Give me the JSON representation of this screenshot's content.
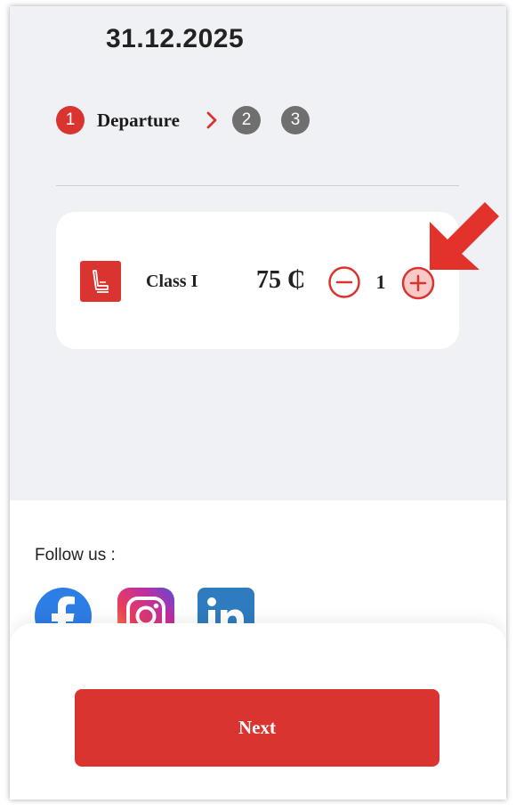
{
  "header": {
    "date": "31.12.2025"
  },
  "steps": [
    {
      "number": "1",
      "label": "Departure",
      "active": true
    },
    {
      "number": "2"
    },
    {
      "number": "3"
    }
  ],
  "booking": {
    "class_label": "Class I",
    "price": "75 ₵",
    "quantity": "1",
    "seat_icon": "seat-icon",
    "minus_icon": "minus-circle-icon",
    "plus_icon": "plus-circle-icon"
  },
  "annotation": {
    "icon": "red-arrow-icon",
    "points_to": "increase-quantity-button"
  },
  "footer": {
    "follow_label": "Follow us :",
    "social": [
      "facebook-icon",
      "instagram-icon",
      "linkedin-icon"
    ]
  },
  "actions": {
    "next_label": "Next"
  },
  "colors": {
    "accent": "#d9342f",
    "step_inactive": "#6f6f6f",
    "background": "#f0f1f5",
    "linkedin": "#2f7bbf",
    "facebook": "#2d7de6"
  }
}
